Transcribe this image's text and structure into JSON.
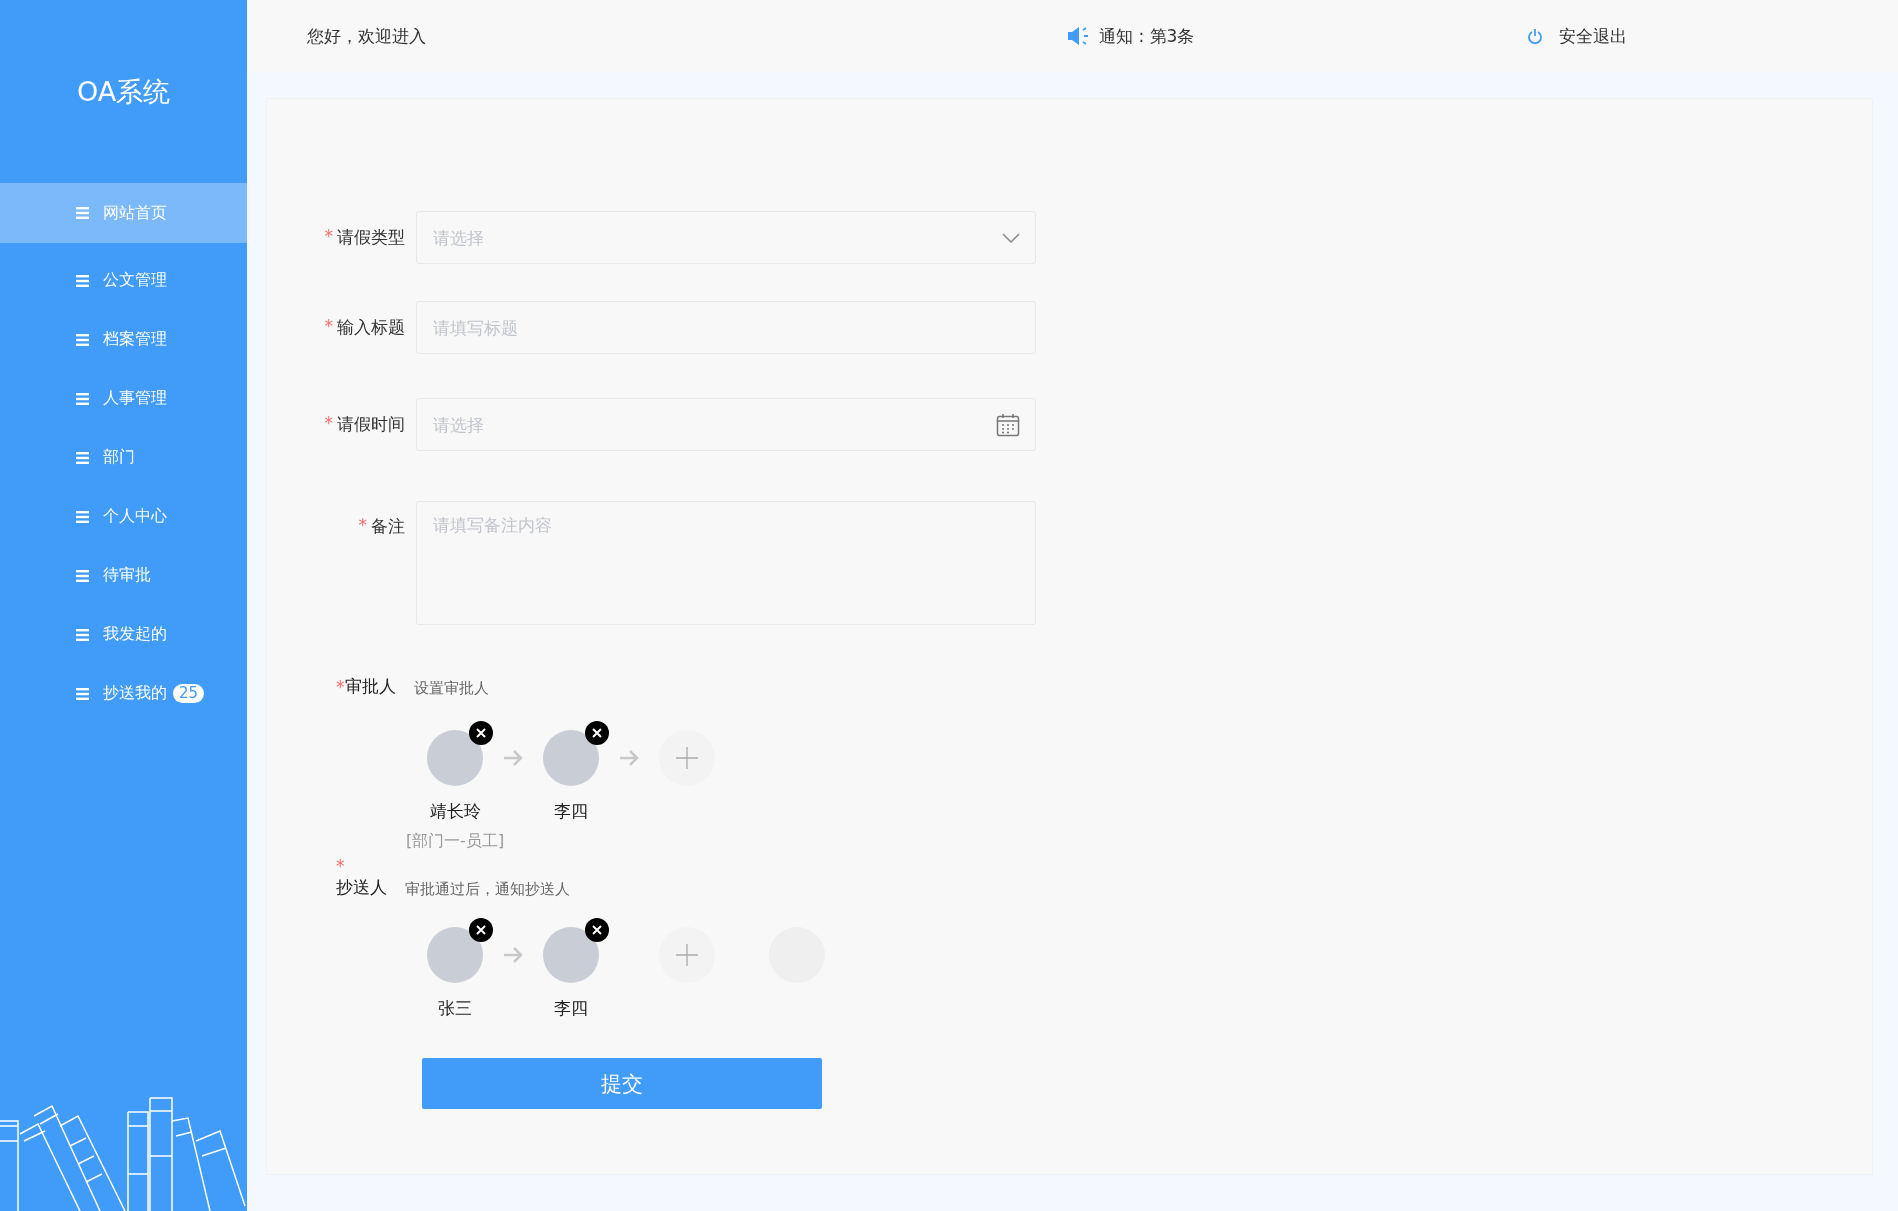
{
  "sidebar": {
    "title": "OA系统",
    "items": [
      {
        "label": "网站首页",
        "selected": true
      },
      {
        "label": "公文管理",
        "selected": false
      },
      {
        "label": "档案管理",
        "selected": false
      },
      {
        "label": "人事管理",
        "selected": false
      },
      {
        "label": "部门",
        "selected": false
      },
      {
        "label": "个人中心",
        "selected": false
      },
      {
        "label": "待审批",
        "selected": false
      },
      {
        "label": "我发起的",
        "selected": false
      },
      {
        "label": "抄送我的",
        "selected": false,
        "badge": "25"
      }
    ]
  },
  "header": {
    "greeting": "您好，欢迎进入",
    "notice": "通知 : 第3条",
    "logout": "安全退出"
  },
  "form": {
    "fields": [
      {
        "kind": "select",
        "required_mark": "*",
        "label": "请假类型",
        "placeholder": "请选择"
      },
      {
        "kind": "text",
        "required_mark": "*",
        "label": "输入标题",
        "placeholder": "请填写标题"
      },
      {
        "kind": "date",
        "required_mark": "*",
        "label": "请假时间",
        "placeholder": "请选择"
      },
      {
        "kind": "textarea",
        "required_mark": "*",
        "label": "备注",
        "placeholder": "请填写备注内容"
      }
    ],
    "approvers": {
      "required_mark": "*",
      "label": "审批人",
      "hint": "设置审批人",
      "people": [
        {
          "name": "靖长玲",
          "role": "[部门一-员工]"
        },
        {
          "name": "李四"
        }
      ]
    },
    "cc": {
      "required_mark": "*",
      "label": "抄送人",
      "hint": "审批通过后，通知抄送人",
      "people": [
        {
          "name": "张三"
        },
        {
          "name": "李四"
        }
      ]
    },
    "submit": "提交"
  }
}
